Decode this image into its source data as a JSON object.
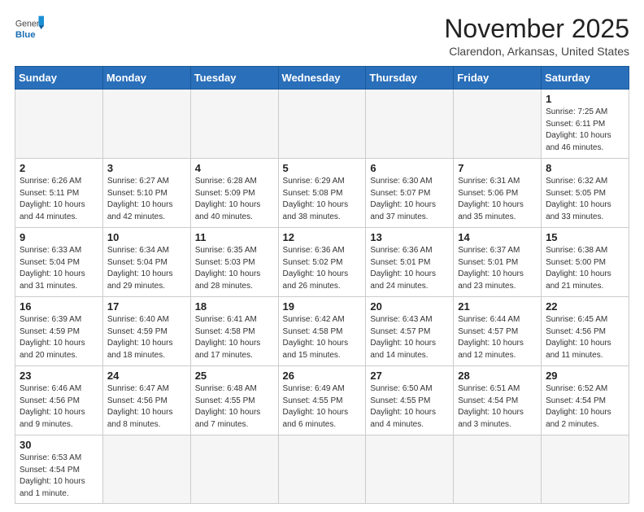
{
  "header": {
    "logo_general": "General",
    "logo_blue": "Blue",
    "month_title": "November 2025",
    "location": "Clarendon, Arkansas, United States"
  },
  "days_of_week": [
    "Sunday",
    "Monday",
    "Tuesday",
    "Wednesday",
    "Thursday",
    "Friday",
    "Saturday"
  ],
  "weeks": [
    [
      {
        "num": "",
        "info": ""
      },
      {
        "num": "",
        "info": ""
      },
      {
        "num": "",
        "info": ""
      },
      {
        "num": "",
        "info": ""
      },
      {
        "num": "",
        "info": ""
      },
      {
        "num": "",
        "info": ""
      },
      {
        "num": "1",
        "info": "Sunrise: 7:25 AM\nSunset: 6:11 PM\nDaylight: 10 hours and 46 minutes."
      }
    ],
    [
      {
        "num": "2",
        "info": "Sunrise: 6:26 AM\nSunset: 5:11 PM\nDaylight: 10 hours and 44 minutes."
      },
      {
        "num": "3",
        "info": "Sunrise: 6:27 AM\nSunset: 5:10 PM\nDaylight: 10 hours and 42 minutes."
      },
      {
        "num": "4",
        "info": "Sunrise: 6:28 AM\nSunset: 5:09 PM\nDaylight: 10 hours and 40 minutes."
      },
      {
        "num": "5",
        "info": "Sunrise: 6:29 AM\nSunset: 5:08 PM\nDaylight: 10 hours and 38 minutes."
      },
      {
        "num": "6",
        "info": "Sunrise: 6:30 AM\nSunset: 5:07 PM\nDaylight: 10 hours and 37 minutes."
      },
      {
        "num": "7",
        "info": "Sunrise: 6:31 AM\nSunset: 5:06 PM\nDaylight: 10 hours and 35 minutes."
      },
      {
        "num": "8",
        "info": "Sunrise: 6:32 AM\nSunset: 5:05 PM\nDaylight: 10 hours and 33 minutes."
      }
    ],
    [
      {
        "num": "9",
        "info": "Sunrise: 6:33 AM\nSunset: 5:04 PM\nDaylight: 10 hours and 31 minutes."
      },
      {
        "num": "10",
        "info": "Sunrise: 6:34 AM\nSunset: 5:04 PM\nDaylight: 10 hours and 29 minutes."
      },
      {
        "num": "11",
        "info": "Sunrise: 6:35 AM\nSunset: 5:03 PM\nDaylight: 10 hours and 28 minutes."
      },
      {
        "num": "12",
        "info": "Sunrise: 6:36 AM\nSunset: 5:02 PM\nDaylight: 10 hours and 26 minutes."
      },
      {
        "num": "13",
        "info": "Sunrise: 6:36 AM\nSunset: 5:01 PM\nDaylight: 10 hours and 24 minutes."
      },
      {
        "num": "14",
        "info": "Sunrise: 6:37 AM\nSunset: 5:01 PM\nDaylight: 10 hours and 23 minutes."
      },
      {
        "num": "15",
        "info": "Sunrise: 6:38 AM\nSunset: 5:00 PM\nDaylight: 10 hours and 21 minutes."
      }
    ],
    [
      {
        "num": "16",
        "info": "Sunrise: 6:39 AM\nSunset: 4:59 PM\nDaylight: 10 hours and 20 minutes."
      },
      {
        "num": "17",
        "info": "Sunrise: 6:40 AM\nSunset: 4:59 PM\nDaylight: 10 hours and 18 minutes."
      },
      {
        "num": "18",
        "info": "Sunrise: 6:41 AM\nSunset: 4:58 PM\nDaylight: 10 hours and 17 minutes."
      },
      {
        "num": "19",
        "info": "Sunrise: 6:42 AM\nSunset: 4:58 PM\nDaylight: 10 hours and 15 minutes."
      },
      {
        "num": "20",
        "info": "Sunrise: 6:43 AM\nSunset: 4:57 PM\nDaylight: 10 hours and 14 minutes."
      },
      {
        "num": "21",
        "info": "Sunrise: 6:44 AM\nSunset: 4:57 PM\nDaylight: 10 hours and 12 minutes."
      },
      {
        "num": "22",
        "info": "Sunrise: 6:45 AM\nSunset: 4:56 PM\nDaylight: 10 hours and 11 minutes."
      }
    ],
    [
      {
        "num": "23",
        "info": "Sunrise: 6:46 AM\nSunset: 4:56 PM\nDaylight: 10 hours and 9 minutes."
      },
      {
        "num": "24",
        "info": "Sunrise: 6:47 AM\nSunset: 4:56 PM\nDaylight: 10 hours and 8 minutes."
      },
      {
        "num": "25",
        "info": "Sunrise: 6:48 AM\nSunset: 4:55 PM\nDaylight: 10 hours and 7 minutes."
      },
      {
        "num": "26",
        "info": "Sunrise: 6:49 AM\nSunset: 4:55 PM\nDaylight: 10 hours and 6 minutes."
      },
      {
        "num": "27",
        "info": "Sunrise: 6:50 AM\nSunset: 4:55 PM\nDaylight: 10 hours and 4 minutes."
      },
      {
        "num": "28",
        "info": "Sunrise: 6:51 AM\nSunset: 4:54 PM\nDaylight: 10 hours and 3 minutes."
      },
      {
        "num": "29",
        "info": "Sunrise: 6:52 AM\nSunset: 4:54 PM\nDaylight: 10 hours and 2 minutes."
      }
    ],
    [
      {
        "num": "30",
        "info": "Sunrise: 6:53 AM\nSunset: 4:54 PM\nDaylight: 10 hours and 1 minute."
      },
      {
        "num": "",
        "info": ""
      },
      {
        "num": "",
        "info": ""
      },
      {
        "num": "",
        "info": ""
      },
      {
        "num": "",
        "info": ""
      },
      {
        "num": "",
        "info": ""
      },
      {
        "num": "",
        "info": ""
      }
    ]
  ]
}
